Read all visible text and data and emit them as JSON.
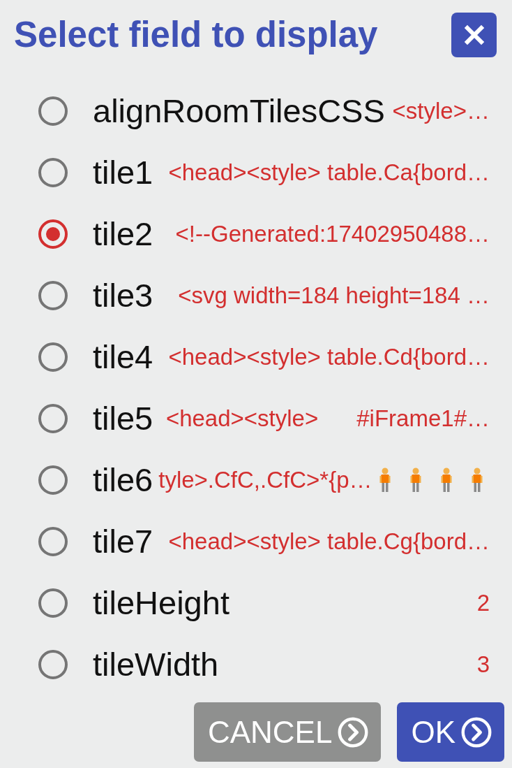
{
  "dialog": {
    "title": "Select field to display"
  },
  "fields": [
    {
      "name": "alignRoomTilesCSS",
      "value": "<style>…",
      "selected": false,
      "kind": "plain"
    },
    {
      "name": "tile1",
      "value": "<head><style> table.Ca{bord…",
      "selected": false,
      "kind": "plain"
    },
    {
      "name": "tile2",
      "value": "<!--Generated:17402950488…",
      "selected": true,
      "kind": "plain"
    },
    {
      "name": "tile3",
      "value": "<svg width=184 height=184 …",
      "selected": false,
      "kind": "plain"
    },
    {
      "name": "tile4",
      "value": "<head><style> table.Cd{bord…",
      "selected": false,
      "kind": "plain"
    },
    {
      "name": "tile5",
      "value": "<head><style>      #iFrame1#…",
      "selected": false,
      "kind": "plain"
    },
    {
      "name": "tile6",
      "value": "tyle>.CfC,.CfC>*{p…",
      "selected": false,
      "kind": "figures"
    },
    {
      "name": "tile7",
      "value": "<head><style> table.Cg{bord…",
      "selected": false,
      "kind": "plain"
    },
    {
      "name": "tileHeight",
      "value": "2",
      "selected": false,
      "kind": "plain"
    },
    {
      "name": "tileWidth",
      "value": "3",
      "selected": false,
      "kind": "plain"
    }
  ],
  "buttons": [
    {
      "label": "CANCEL",
      "kind": "secondary"
    },
    {
      "label": "OK",
      "kind": "primary"
    }
  ]
}
